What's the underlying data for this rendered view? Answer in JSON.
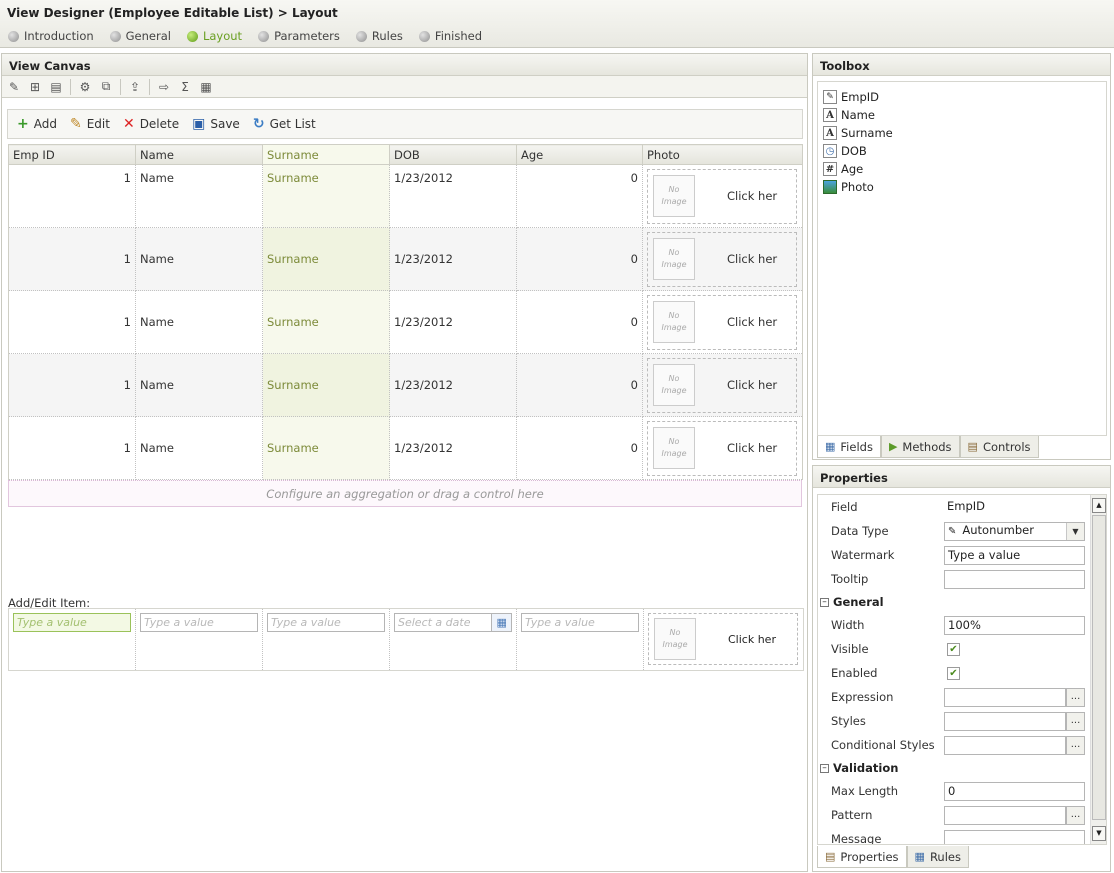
{
  "header": {
    "title": "View Designer (Employee Editable List) > Layout",
    "steps": [
      {
        "label": "Introduction",
        "active": false
      },
      {
        "label": "General",
        "active": false
      },
      {
        "label": "Layout",
        "active": true
      },
      {
        "label": "Parameters",
        "active": false
      },
      {
        "label": "Rules",
        "active": false
      },
      {
        "label": "Finished",
        "active": false
      }
    ]
  },
  "canvas": {
    "title": "View Canvas",
    "toolbar_icons": [
      "wand-icon",
      "add-grid-icon",
      "edit-grid-icon",
      "settings-icon",
      "binoculars-icon",
      "export-icon",
      "import-icon",
      "sigma-icon",
      "notepad-icon"
    ],
    "list_toolbar": {
      "add": "Add",
      "edit": "Edit",
      "delete": "Delete",
      "save": "Save",
      "get_list": "Get List"
    },
    "columns": [
      "Emp ID",
      "Name",
      "Surname",
      "DOB",
      "Age",
      "Photo"
    ],
    "rows": [
      {
        "emp_id": "1",
        "name": "Name",
        "surname": "Surname",
        "dob": "1/23/2012",
        "age": "0"
      },
      {
        "emp_id": "1",
        "name": "Name",
        "surname": "Surname",
        "dob": "1/23/2012",
        "age": "0"
      },
      {
        "emp_id": "1",
        "name": "Name",
        "surname": "Surname",
        "dob": "1/23/2012",
        "age": "0"
      },
      {
        "emp_id": "1",
        "name": "Name",
        "surname": "Surname",
        "dob": "1/23/2012",
        "age": "0"
      },
      {
        "emp_id": "1",
        "name": "Name",
        "surname": "Surname",
        "dob": "1/23/2012",
        "age": "0"
      }
    ],
    "no_image_line1": "No",
    "no_image_line2": "Image",
    "click_here": "Click her",
    "aggregation_hint": "Configure an aggregation or drag a control here",
    "add_edit_label": "Add/Edit Item:",
    "add_edit_placeholder": "Type a value",
    "add_edit_date_placeholder": "Select a date"
  },
  "toolbox": {
    "title": "Toolbox",
    "fields": [
      {
        "label": "EmpID",
        "icon": "autonumber-icon"
      },
      {
        "label": "Name",
        "icon": "text-field-icon"
      },
      {
        "label": "Surname",
        "icon": "text-field-icon"
      },
      {
        "label": "DOB",
        "icon": "date-field-icon"
      },
      {
        "label": "Age",
        "icon": "number-field-icon"
      },
      {
        "label": "Photo",
        "icon": "image-field-icon"
      }
    ],
    "tabs": [
      "Fields",
      "Methods",
      "Controls"
    ]
  },
  "properties": {
    "title": "Properties",
    "field_label": "Field",
    "field_value": "EmpID",
    "data_type_label": "Data Type",
    "data_type_value": "Autonumber",
    "watermark_label": "Watermark",
    "watermark_value": "Type a value",
    "tooltip_label": "Tooltip",
    "tooltip_value": "",
    "general_section": "General",
    "width_label": "Width",
    "width_value": "100%",
    "visible_label": "Visible",
    "visible_checked": true,
    "enabled_label": "Enabled",
    "enabled_checked": true,
    "expression_label": "Expression",
    "styles_label": "Styles",
    "conditional_styles_label": "Conditional Styles",
    "validation_section": "Validation",
    "max_length_label": "Max Length",
    "max_length_value": "0",
    "pattern_label": "Pattern",
    "message_label": "Message",
    "ellipsis": "...",
    "tabs": [
      "Properties",
      "Rules"
    ]
  },
  "colors": {
    "accent_green": "#6aa022",
    "surname_column": "#f7f9ec"
  }
}
